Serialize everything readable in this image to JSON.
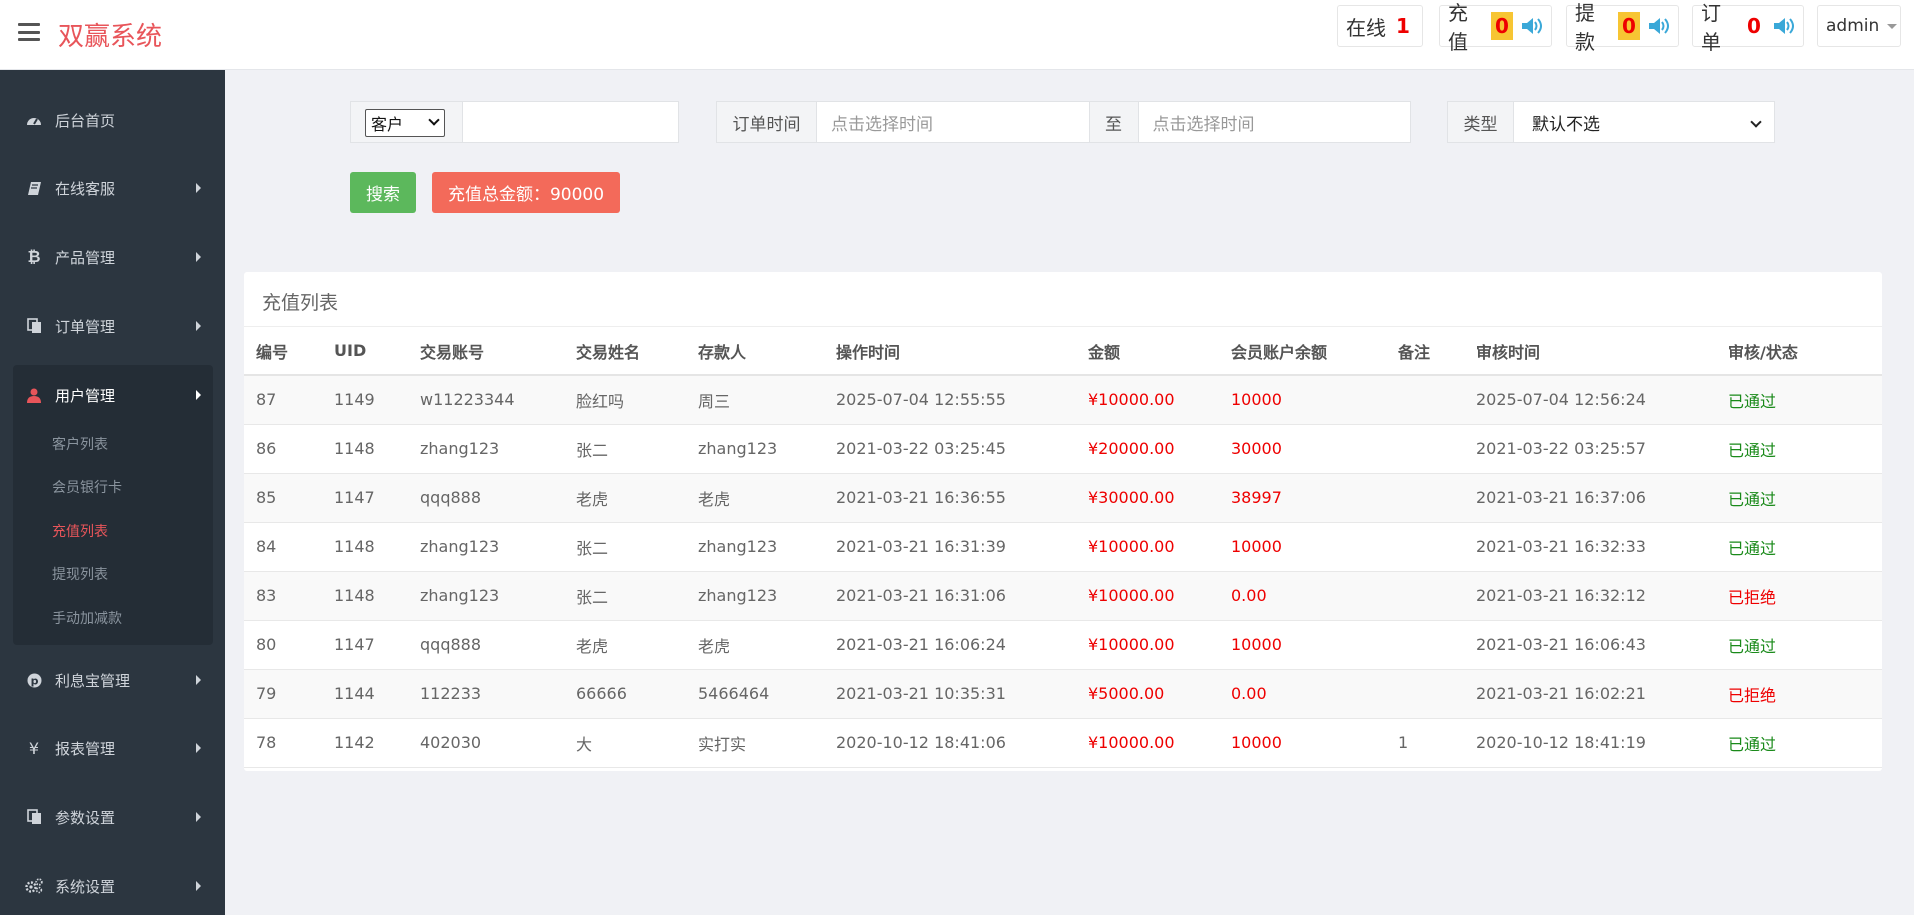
{
  "header": {
    "brand": "双赢系统",
    "online_label": "在线",
    "online_count": "1",
    "recharge_label": "充值",
    "recharge_count": "0",
    "withdraw_label": "提款",
    "withdraw_count": "0",
    "order_label": "订单",
    "order_count": "0",
    "user": "admin"
  },
  "sidebar": {
    "items": [
      {
        "label": "后台首页",
        "icon": "dashboard-icon"
      },
      {
        "label": "在线客服",
        "icon": "book-icon"
      },
      {
        "label": "产品管理",
        "icon": "bitcoin-icon"
      },
      {
        "label": "订单管理",
        "icon": "copy-icon"
      },
      {
        "label": "用户管理",
        "icon": "user-icon"
      },
      {
        "label": "利息宝管理",
        "icon": "pinterest-icon"
      },
      {
        "label": "报表管理",
        "icon": "yen-icon"
      },
      {
        "label": "参数设置",
        "icon": "copy-icon"
      },
      {
        "label": "系统设置",
        "icon": "cogs-icon"
      }
    ],
    "sub_items": [
      "客户列表",
      "会员银行卡",
      "充值列表",
      "提现列表",
      "手动加减款"
    ]
  },
  "filters": {
    "customer_select": "客户",
    "customer_value": "",
    "order_time_label": "订单时间",
    "time_placeholder_start": "点击选择时间",
    "to_label": "至",
    "time_placeholder_end": "点击选择时间",
    "type_label": "类型",
    "type_value": "默认不选"
  },
  "actions": {
    "search_label": "搜索",
    "total_label": "充值总金额：90000"
  },
  "panel": {
    "title": "充值列表",
    "columns": [
      "编号",
      "UID",
      "交易账号",
      "交易姓名",
      "存款人",
      "操作时间",
      "金额",
      "会员账户余额",
      "备注",
      "审核时间",
      "审核/状态"
    ],
    "rows": [
      [
        "87",
        "1149",
        "w11223344",
        "脸红吗",
        "周三",
        "2025-07-04 12:55:55",
        "¥10000.00",
        "10000",
        "",
        "2025-07-04 12:56:24",
        "已通过"
      ],
      [
        "86",
        "1148",
        "zhang123",
        "张二",
        "zhang123",
        "2021-03-22 03:25:45",
        "¥20000.00",
        "30000",
        "",
        "2021-03-22 03:25:57",
        "已通过"
      ],
      [
        "85",
        "1147",
        "qqq888",
        "老虎",
        "老虎",
        "2021-03-21 16:36:55",
        "¥30000.00",
        "38997",
        "",
        "2021-03-21 16:37:06",
        "已通过"
      ],
      [
        "84",
        "1148",
        "zhang123",
        "张二",
        "zhang123",
        "2021-03-21 16:31:39",
        "¥10000.00",
        "10000",
        "",
        "2021-03-21 16:32:33",
        "已通过"
      ],
      [
        "83",
        "1148",
        "zhang123",
        "张二",
        "zhang123",
        "2021-03-21 16:31:06",
        "¥10000.00",
        "0.00",
        "",
        "2021-03-21 16:32:12",
        "已拒绝"
      ],
      [
        "80",
        "1147",
        "qqq888",
        "老虎",
        "老虎",
        "2021-03-21 16:06:24",
        "¥10000.00",
        "10000",
        "",
        "2021-03-21 16:06:43",
        "已通过"
      ],
      [
        "79",
        "1144",
        "112233",
        "66666",
        "5466464",
        "2021-03-21 10:35:31",
        "¥5000.00",
        "0.00",
        "",
        "2021-03-21 16:02:21",
        "已拒绝"
      ],
      [
        "78",
        "1142",
        "402030",
        "大",
        "实打实",
        "2020-10-12 18:41:06",
        "¥10000.00",
        "10000",
        "1",
        "2020-10-12 18:41:19",
        "已通过"
      ]
    ]
  },
  "colors": {
    "brand": "#e8555a",
    "sidebar_bg": "#2c3640",
    "search_button": "#5cb85c",
    "total_badge": "#f36a5a",
    "approved": "#1a8a1a",
    "rejected": "#ee0000"
  }
}
